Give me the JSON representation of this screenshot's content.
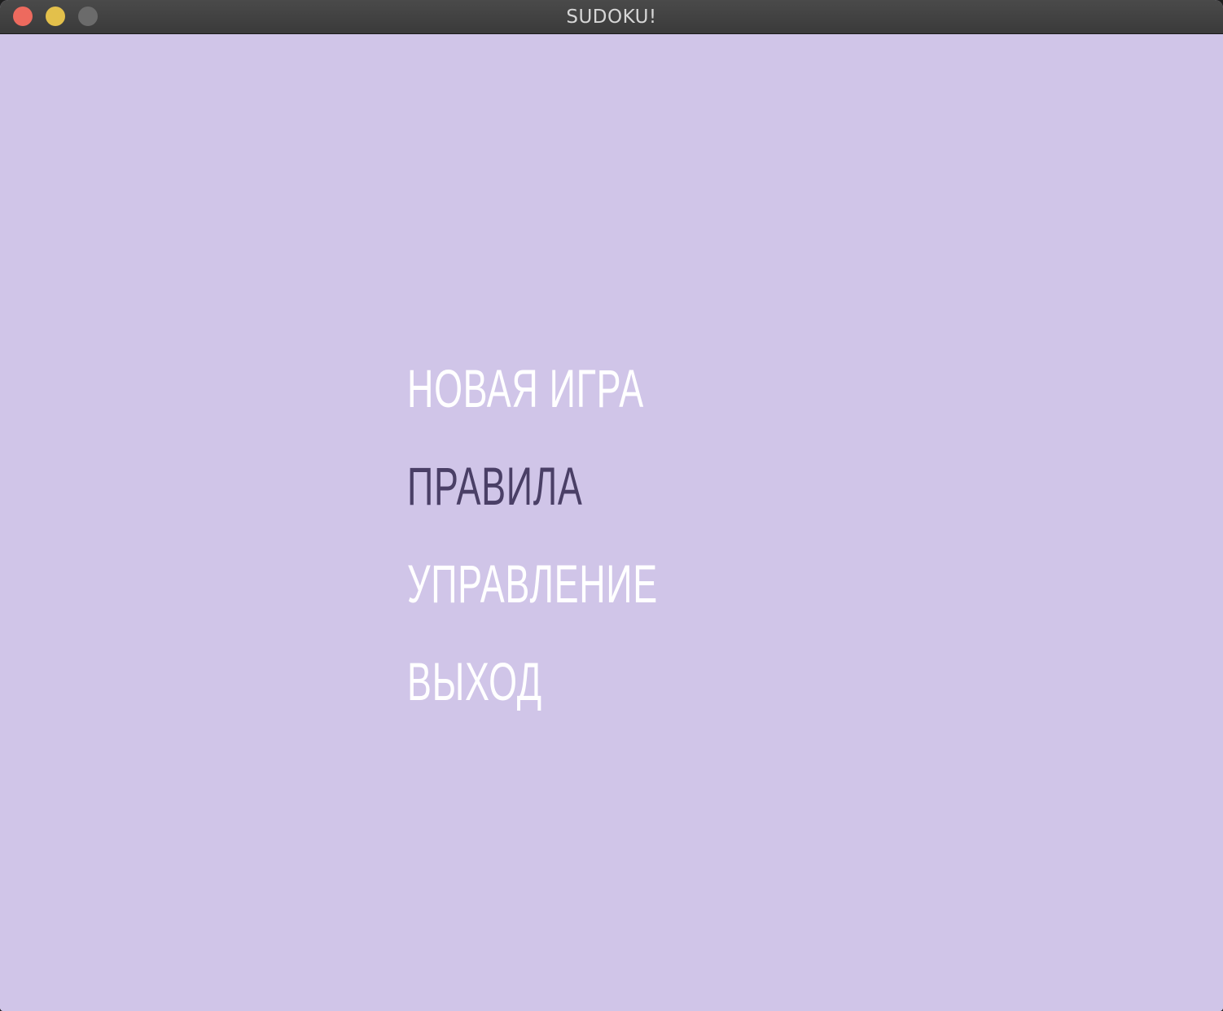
{
  "window": {
    "title": "SUDOKU!"
  },
  "menu": {
    "items": [
      {
        "label": "НОВАЯ ИГРА",
        "active": false
      },
      {
        "label": "ПРАВИЛА",
        "active": true
      },
      {
        "label": "УПРАВЛЕНИЕ",
        "active": false
      },
      {
        "label": "ВЫХОД",
        "active": false
      }
    ]
  },
  "colors": {
    "background": "#d0c5e8",
    "item_default": "#ffffff",
    "item_highlighted": "#4a3f66"
  }
}
